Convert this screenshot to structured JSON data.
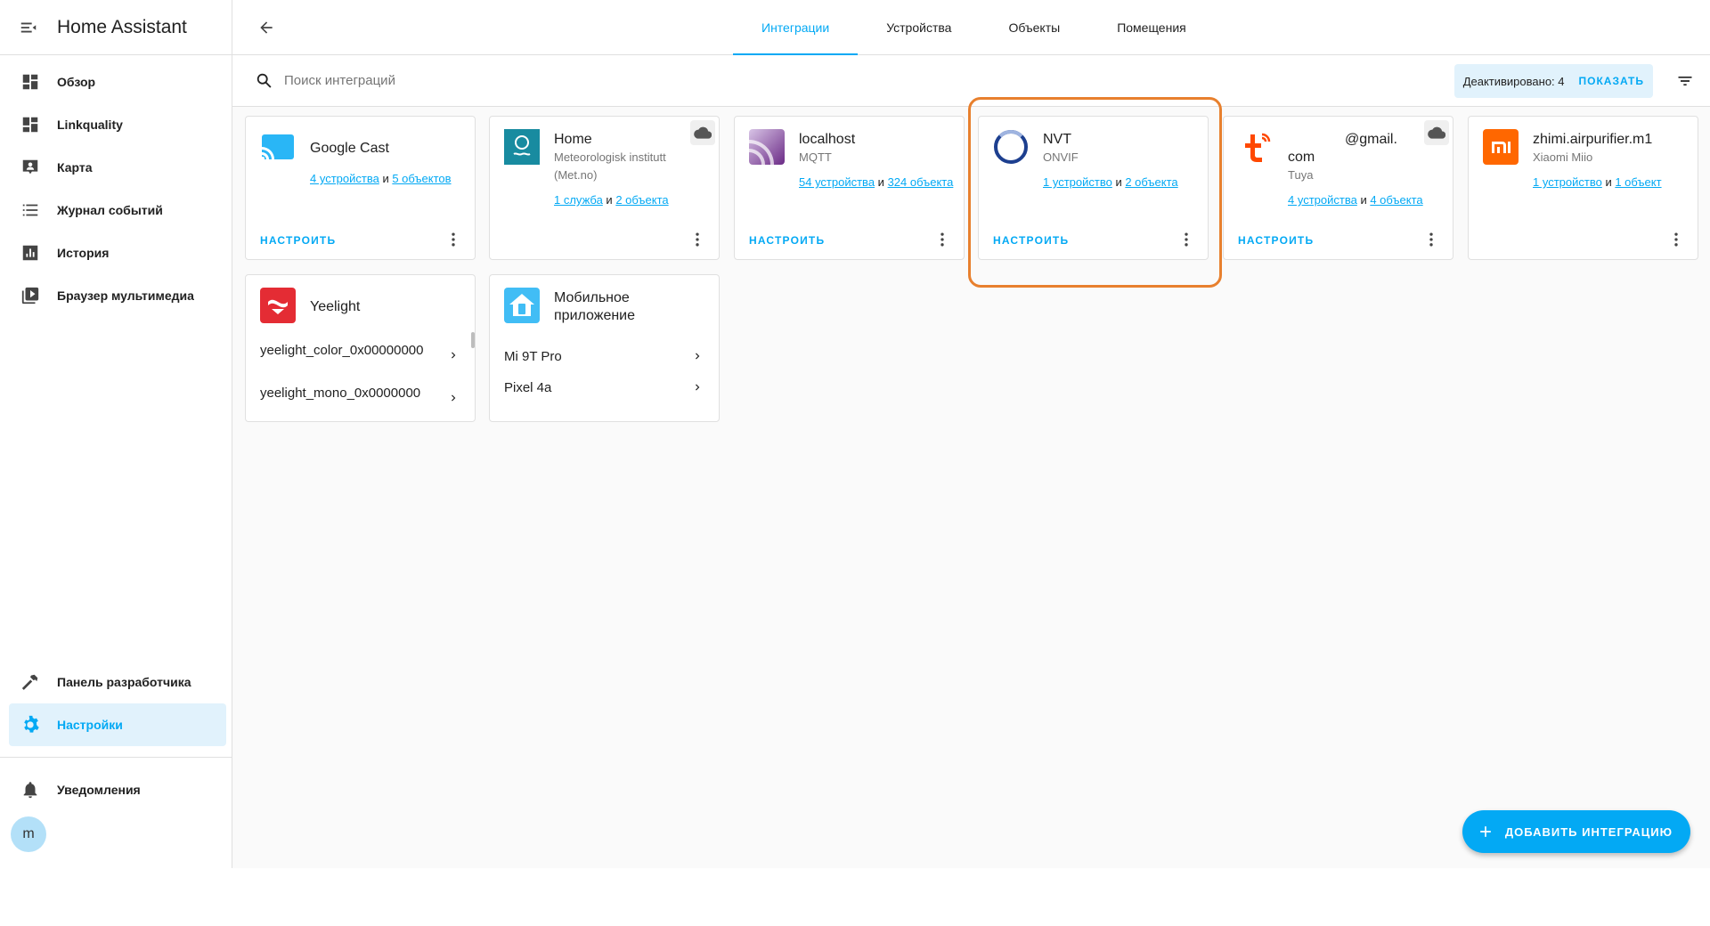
{
  "app": {
    "title": "Home Assistant"
  },
  "sidebar": {
    "items": [
      {
        "label": "Обзор",
        "icon": "dashboard-icon"
      },
      {
        "label": "Linkquality",
        "icon": "dashboard-icon"
      },
      {
        "label": "Карта",
        "icon": "map-account-icon"
      },
      {
        "label": "Журнал событий",
        "icon": "format-list-icon"
      },
      {
        "label": "История",
        "icon": "chart-box-icon"
      },
      {
        "label": "Браузер мультимедиа",
        "icon": "play-box-icon"
      }
    ],
    "developer": {
      "label": "Панель разработчика",
      "icon": "hammer-icon"
    },
    "settings": {
      "label": "Настройки",
      "icon": "gear-icon",
      "active": true
    },
    "notifications": {
      "label": "Уведомления",
      "icon": "bell-icon"
    },
    "user": {
      "initial": "m"
    }
  },
  "tabs": [
    {
      "label": "Интеграции",
      "active": true
    },
    {
      "label": "Устройства"
    },
    {
      "label": "Объекты"
    },
    {
      "label": "Помещения"
    }
  ],
  "search": {
    "placeholder": "Поиск интеграций",
    "value": ""
  },
  "disabled": {
    "label": "Деактивировано: 4",
    "action": "ПОКАЗАТЬ"
  },
  "cards": {
    "google_cast": {
      "title": "Google Cast",
      "devices": "4 устройства",
      "joiner": "и",
      "entities": "5 объектов",
      "configure": "НАСТРОИТЬ"
    },
    "met": {
      "title": "Home",
      "sub": "Meteorologisk institutt (Met.no)",
      "devices": "1 служба",
      "joiner": "и",
      "entities": "2 объекта"
    },
    "mqtt": {
      "title": "localhost",
      "sub": "MQTT",
      "devices": "54 устройства",
      "joiner": "и",
      "entities": "324 объекта",
      "configure": "НАСТРОИТЬ"
    },
    "onvif": {
      "title": "NVT",
      "sub": "ONVIF",
      "devices": "1 устройство",
      "joiner": "и",
      "entities": "2 объекта",
      "configure": "НАСТРОИТЬ"
    },
    "tuya": {
      "title_a": "@gmail.",
      "title_b": "com",
      "sub": "Tuya",
      "devices": "4 устройства",
      "joiner": "и",
      "entities": "4 объекта",
      "configure": "НАСТРОИТЬ"
    },
    "xiaomi": {
      "title": "zhimi.airpurifier.m1",
      "sub": "Xiaomi Miio",
      "devices": "1 устройство",
      "joiner": "и",
      "entities": "1 объект",
      "logo_text": "mi"
    },
    "yeelight": {
      "title": "Yeelight",
      "rows": [
        "yeelight_color_0x00000000",
        "yeelight_mono_0x0000000"
      ]
    },
    "mobile": {
      "title": "Мобильное приложение",
      "rows": [
        "Mi 9T Pro",
        "Pixel 4a"
      ]
    }
  },
  "fab": {
    "label": "ДОБАВИТЬ ИНТЕГРАЦИЮ"
  },
  "colors": {
    "accent": "#03a9f4",
    "highlight": "#e8802e",
    "tuya": "#ff4800",
    "xiaomi": "#ff6700",
    "yeelight": "#e42c34",
    "met": "#188ba0"
  }
}
